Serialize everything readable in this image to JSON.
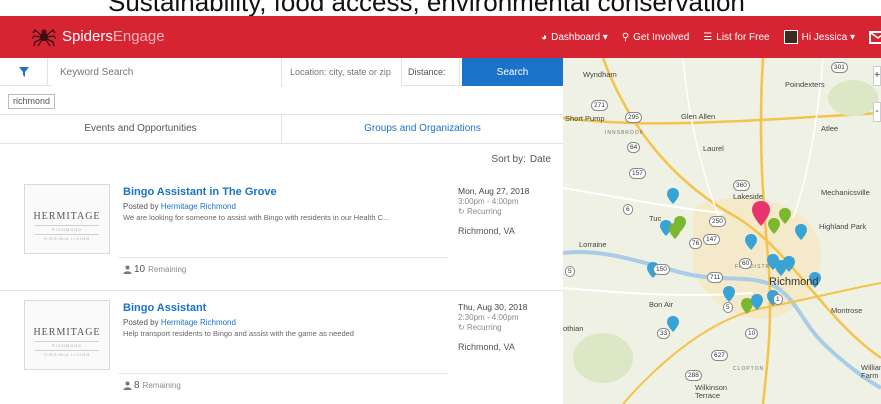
{
  "caption": "Sustainability, food access, environmental conservation",
  "navbar": {
    "brand_primary": "Spiders",
    "brand_secondary": "Engage",
    "items": [
      {
        "label": "Dashboard ▾",
        "icon": "dashboard-icon"
      },
      {
        "label": "Get Involved",
        "icon": "search-icon"
      },
      {
        "label": "List for Free",
        "icon": "list-icon"
      },
      {
        "label": "Hi Jessica ▾",
        "icon": "avatar"
      }
    ],
    "mail_icon": "mail-icon"
  },
  "search": {
    "keyword_placeholder": "Keyword Search",
    "location_placeholder": "Location: city, state or zip",
    "distance_label": "Distance:",
    "button_label": "Search"
  },
  "filter_chip": "richmond",
  "tabs": {
    "events": "Events and Opportunities",
    "groups": "Groups and Organizations"
  },
  "sort": {
    "label": "Sort by:",
    "value": "Date"
  },
  "listings": [
    {
      "thumbnail_text": "HERMITAGE",
      "thumbnail_sub1": "RICHMOND",
      "thumbnail_sub2": "VIRGINIA LIVING",
      "title": "Bingo Assistant in The Grove",
      "posted_prefix": "Posted by",
      "posted_by": "Hermitage Richmond",
      "description": "We are looking for someone to assist with Bingo with residents in our Health C...",
      "date": "Mon, Aug 27, 2018",
      "time": "3:00pm - 4:00pm",
      "recurring": "Recurring",
      "location": "Richmond, VA",
      "remaining_count": "10",
      "remaining_label": "Remaining"
    },
    {
      "thumbnail_text": "HERMITAGE",
      "thumbnail_sub1": "RICHMOND",
      "thumbnail_sub2": "VIRGINIA LIVING",
      "title": "Bingo Assistant",
      "posted_prefix": "Posted by",
      "posted_by": "Hermitage Richmond",
      "description": "Help transport residents to Bingo and assist with the game as needed",
      "date": "Thu, Aug 30, 2018",
      "time": "2:30pm - 4:00pm",
      "recurring": "Recurring",
      "location": "Richmond, VA",
      "remaining_count": "8",
      "remaining_label": "Remaining"
    }
  ],
  "map": {
    "labels": {
      "wyndham": "Wyndham",
      "poindexters": "Poindexters",
      "short_pump": "Short Pump",
      "glen_allen": "Glen Allen",
      "atlee": "Atlee",
      "innsbrook": "INNSBROOK",
      "laurel": "Laurel",
      "lakeside": "Lakeside",
      "mechanicsville": "Mechanicsville",
      "highland_park": "Highland Park",
      "tuckahoe": "Tuc",
      "lorraine": "Lorraine",
      "fan_district": "FAN DISTR",
      "richmond": "Richmond",
      "bon_air": "Bon Air",
      "montrose": "Montrose",
      "midlothian": "othian",
      "clopton": "CLOPTON",
      "wilkinson_terrace": "Wilkinson Terrace",
      "williams_farm": "William Farm"
    },
    "route_numbers": [
      "271",
      "295",
      "64",
      "301",
      "360",
      "157",
      "6",
      "250",
      "147",
      "76",
      "150",
      "60",
      "711",
      "1",
      "5",
      "33",
      "627",
      "288",
      "10",
      "5"
    ],
    "zoom_in": "+",
    "zoom_out": "-"
  },
  "colors": {
    "brand_red": "#d62433",
    "link_blue": "#1a72c9",
    "marker_blue": "#3aa3d6",
    "marker_green": "#7cb82f",
    "marker_pink": "#e8336c"
  }
}
